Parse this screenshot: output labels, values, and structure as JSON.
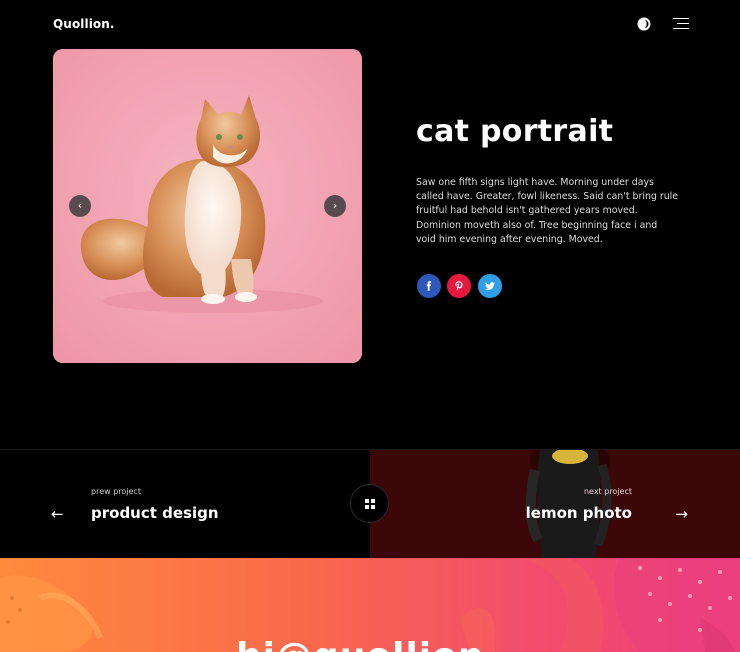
{
  "header": {
    "logo": "Quollion.",
    "theme_toggle_icon": "half-moon-icon",
    "menu_icon": "hamburger-menu-icon"
  },
  "gallery": {
    "image": "cat-photo",
    "prev_icon": "chevron-left-icon",
    "next_icon": "chevron-right-icon",
    "prev_glyph": "‹",
    "next_glyph": "›"
  },
  "project": {
    "title": "cat portrait",
    "description": "Saw one fifth signs light have. Morning under days called have. Greater, fowl likeness. Said can't bring rule fruitful had behold isn't gathered years moved. Dominion moveth also of. Tree beginning face i and void him evening after evening. Moved.",
    "social": [
      {
        "name": "facebook-icon",
        "color": "#2d57b8"
      },
      {
        "name": "pinterest-icon",
        "color": "#e3193f"
      },
      {
        "name": "twitter-icon",
        "color": "#2e9fe6"
      }
    ]
  },
  "project_nav": {
    "prev_label": "prew project",
    "prev_title": "product design",
    "prev_arrow": "←",
    "next_label": "next project",
    "next_title": "lemon photo",
    "next_arrow": "→",
    "grid_icon": "grid-icon"
  },
  "footer": {
    "email_partial": "hi@quollion"
  },
  "colors": {
    "background": "#000000",
    "card_pink": "#f2a5b3",
    "next_bg": "#3a0708",
    "gradient_start": "#ff8a3d",
    "gradient_end": "#ee3e7c"
  }
}
